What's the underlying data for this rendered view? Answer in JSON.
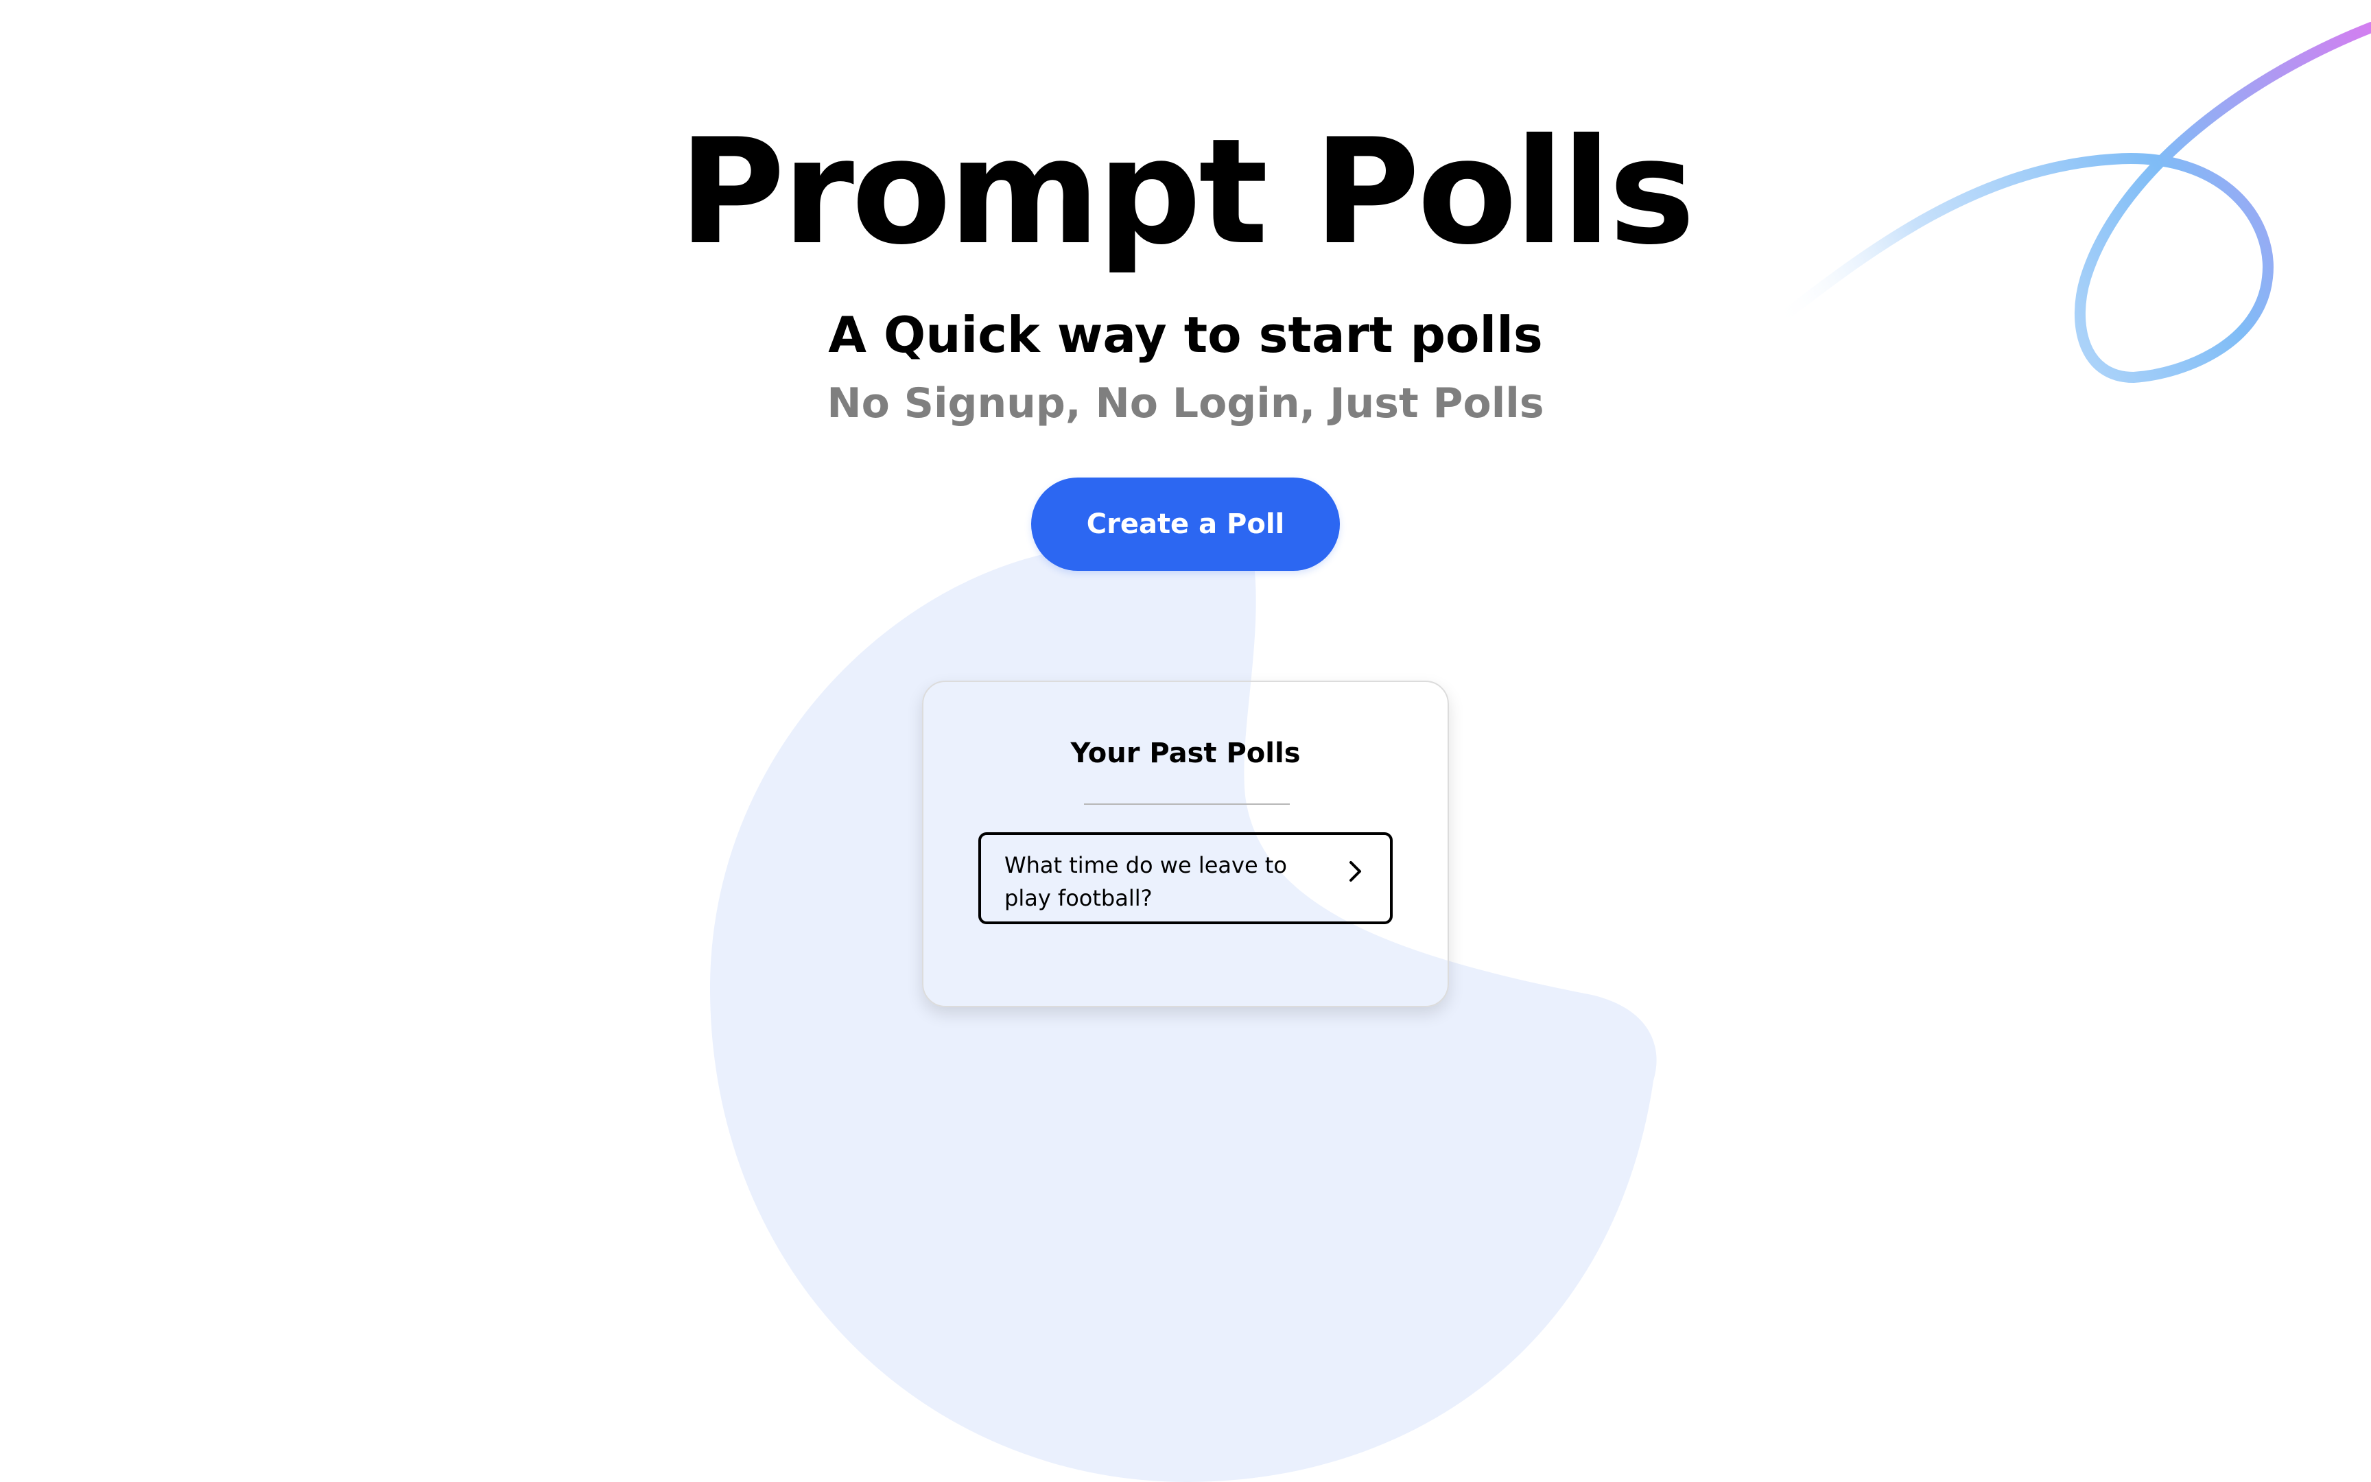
{
  "header": {
    "title": "Prompt Polls",
    "subtitle": "A Quick way to start polls",
    "tagline": "No Signup, No Login, Just Polls"
  },
  "actions": {
    "create_poll_label": "Create a Poll"
  },
  "past_polls": {
    "title": "Your Past Polls",
    "items": [
      {
        "question": "What time do we leave to play football?",
        "icon": "chevron-right-icon"
      }
    ]
  },
  "colors": {
    "background": "#ffffff",
    "primary_button": "#2c67f2",
    "background_blob": "#eaf0fd",
    "tagline_text": "#7f7f7f",
    "decorative_swirl_start": "#7fbcf6",
    "decorative_swirl_end": "#d37ef0"
  },
  "icons": [
    "chevron-right-icon",
    "decorative-swirl-icon"
  ]
}
